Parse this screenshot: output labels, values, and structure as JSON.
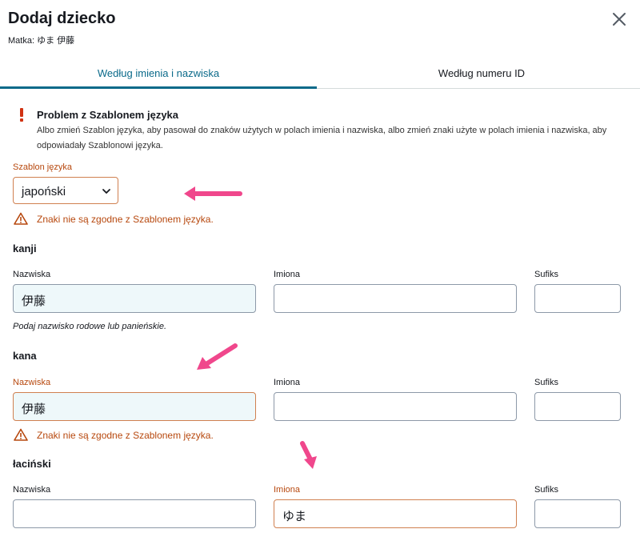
{
  "dialog": {
    "title": "Dodaj dziecko",
    "subtitle": "Matka: ゆま 伊藤"
  },
  "tabs": [
    {
      "label": "Według imienia i nazwiska",
      "active": true
    },
    {
      "label": "Według numeru ID",
      "active": false
    }
  ],
  "problem": {
    "title": "Problem z Szablonem języka",
    "text": "Albo zmień Szablon języka, aby pasował do znaków użytych w polach imienia i nazwiska, albo zmień znaki użyte w polach imienia i nazwiska, aby odpowiadały Szablonowi języka."
  },
  "template": {
    "label": "Szablon języka",
    "selected": "japoński",
    "warning": "Znaki nie są zgodne z Szablonem języka."
  },
  "kanji": {
    "heading": "kanji",
    "surname_label": "Nazwiska",
    "surname_value": "伊藤",
    "given_label": "Imiona",
    "given_value": "",
    "suffix_label": "Sufiks",
    "suffix_value": "",
    "hint": "Podaj nazwisko rodowe lub panieńskie."
  },
  "kana": {
    "heading": "kana",
    "surname_label": "Nazwiska",
    "surname_value": "伊藤",
    "given_label": "Imiona",
    "given_value": "",
    "suffix_label": "Sufiks",
    "suffix_value": "",
    "warning": "Znaki nie są zgodne z Szablonem języka."
  },
  "latin": {
    "heading": "łaciński",
    "surname_label": "Nazwiska",
    "surname_value": "",
    "given_label": "Imiona",
    "given_value": "ゆま",
    "suffix_label": "Sufiks",
    "suffix_value": ""
  },
  "colors": {
    "accent": "#0b6a8a",
    "error": "#b7480e",
    "arrow": "#f0478c"
  }
}
